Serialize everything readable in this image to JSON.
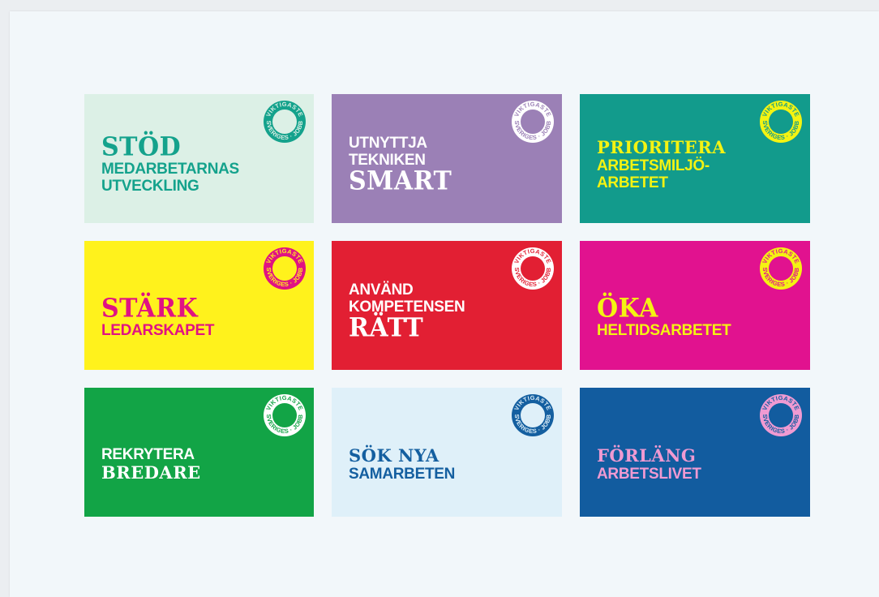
{
  "badge": {
    "top_text": "VIKTIGASTE",
    "bottom_text": "SVERIGES · JOBB"
  },
  "cards": [
    {
      "bg": "#dcf0e6",
      "fg": "#14a28c",
      "badge_color": "#14a28c",
      "lines": [
        {
          "text": "STÖD",
          "style": "big"
        },
        {
          "text": "MEDARBETARNAS",
          "style": "small"
        },
        {
          "text": "UTVECKLING",
          "style": "small"
        }
      ]
    },
    {
      "bg": "#9b80b6",
      "fg": "#ffffff",
      "badge_color": "#ffffff",
      "lines": [
        {
          "text": "UTNYTTJA",
          "style": "small"
        },
        {
          "text": "TEKNIKEN",
          "style": "small"
        },
        {
          "text": "SMART",
          "style": "big"
        }
      ]
    },
    {
      "bg": "#129b8c",
      "fg": "#f4f312",
      "badge_color": "#f4f312",
      "lines": [
        {
          "text": "PRIORITERA",
          "style": "mid"
        },
        {
          "text": "ARBETSMILJÖ-",
          "style": "small"
        },
        {
          "text": "ARBETET",
          "style": "small"
        }
      ]
    },
    {
      "bg": "#fff21c",
      "fg": "#e01283",
      "badge_color": "#e01283",
      "lines": [
        {
          "text": "STÄRK",
          "style": "big"
        },
        {
          "text": "LEDARSKAPET",
          "style": "small"
        }
      ]
    },
    {
      "bg": "#e21f33",
      "fg": "#ffffff",
      "badge_color": "#ffffff",
      "lines": [
        {
          "text": "ANVÄND",
          "style": "small"
        },
        {
          "text": "KOMPETENSEN",
          "style": "small"
        },
        {
          "text": "RÄTT",
          "style": "big"
        }
      ]
    },
    {
      "bg": "#e1128f",
      "fg": "#f4f312",
      "badge_color": "#f4f312",
      "lines": [
        {
          "text": "ÖKA",
          "style": "big"
        },
        {
          "text": "HELTIDSARBETET",
          "style": "small"
        }
      ]
    },
    {
      "bg": "#12a446",
      "fg": "#ffffff",
      "badge_color": "#ffffff",
      "lines": [
        {
          "text": "REKRYTERA",
          "style": "small"
        },
        {
          "text": "BREDARE",
          "style": "mid"
        }
      ]
    },
    {
      "bg": "#dff0f9",
      "fg": "#145fa0",
      "badge_color": "#145fa0",
      "lines": [
        {
          "text": "SÖK NYA",
          "style": "mid"
        },
        {
          "text": "SAMARBETEN",
          "style": "small"
        }
      ]
    },
    {
      "bg": "#125c9f",
      "fg": "#f09ad2",
      "badge_color": "#f09ad2",
      "lines": [
        {
          "text": "FÖRLÄNG",
          "style": "mid"
        },
        {
          "text": "ARBETSLIVET",
          "style": "small"
        }
      ]
    }
  ]
}
